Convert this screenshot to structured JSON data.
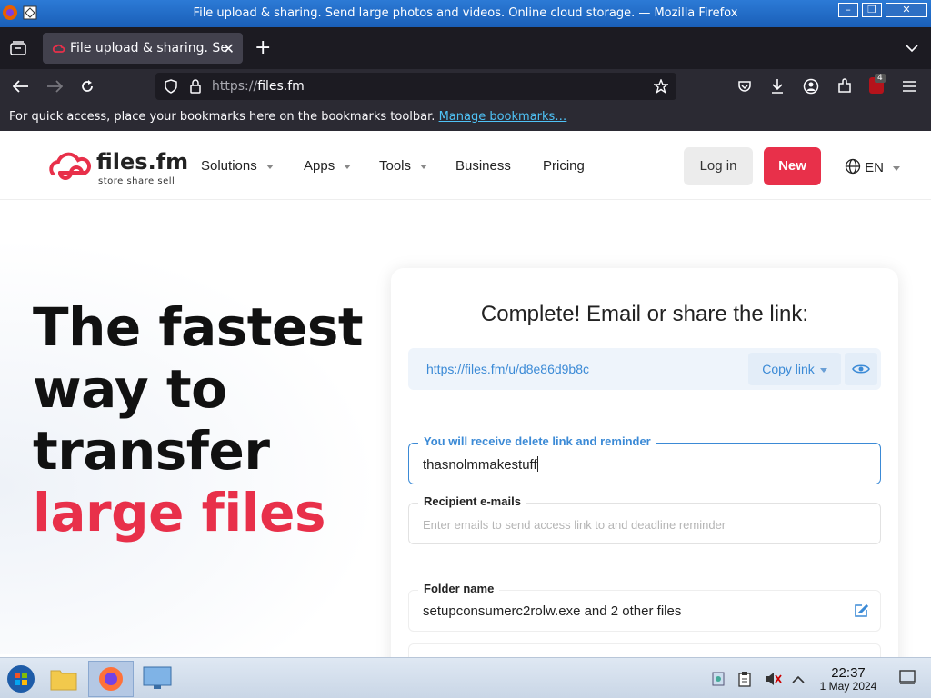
{
  "window": {
    "title": "File upload & sharing. Send large photos and videos. Online cloud storage. — Mozilla Firefox"
  },
  "browser": {
    "tab_title": "File upload & sharing. Se",
    "url_scheme": "https://",
    "url_host": "files.fm",
    "extension_badge": "4",
    "bookmarks_message": "For quick access, place your bookmarks here on the bookmarks toolbar.",
    "bookmarks_link": "Manage bookmarks…"
  },
  "site": {
    "logo_name": "files.fm",
    "logo_tagline": "store  share  sell",
    "menu": {
      "solutions": "Solutions",
      "apps": "Apps",
      "tools": "Tools",
      "business": "Business",
      "pricing": "Pricing"
    },
    "login_label": "Log in",
    "new_label": "New",
    "language": "EN"
  },
  "hero": {
    "line1": "The fastest",
    "line2": "way to",
    "line3": "transfer",
    "line4": "large files"
  },
  "share_card": {
    "title": "Complete! Email or share the link:",
    "share_link": "https://files.fm/u/d8e86d9b8c",
    "copy_label": "Copy link",
    "owner_email_label": "You will receive delete link and reminder",
    "owner_email_value": "thasnolmmakestuff",
    "recipient_label": "Recipient e-mails",
    "recipient_placeholder": "Enter emails to send access link to and deadline reminder",
    "folder_label": "Folder name",
    "folder_value": "setupconsumerc2rolw.exe and 2 other files"
  },
  "taskbar": {
    "time": "22:37",
    "date": "1 May 2024"
  },
  "colors": {
    "brand_red": "#e8304a",
    "link_blue": "#3b8ad6"
  }
}
